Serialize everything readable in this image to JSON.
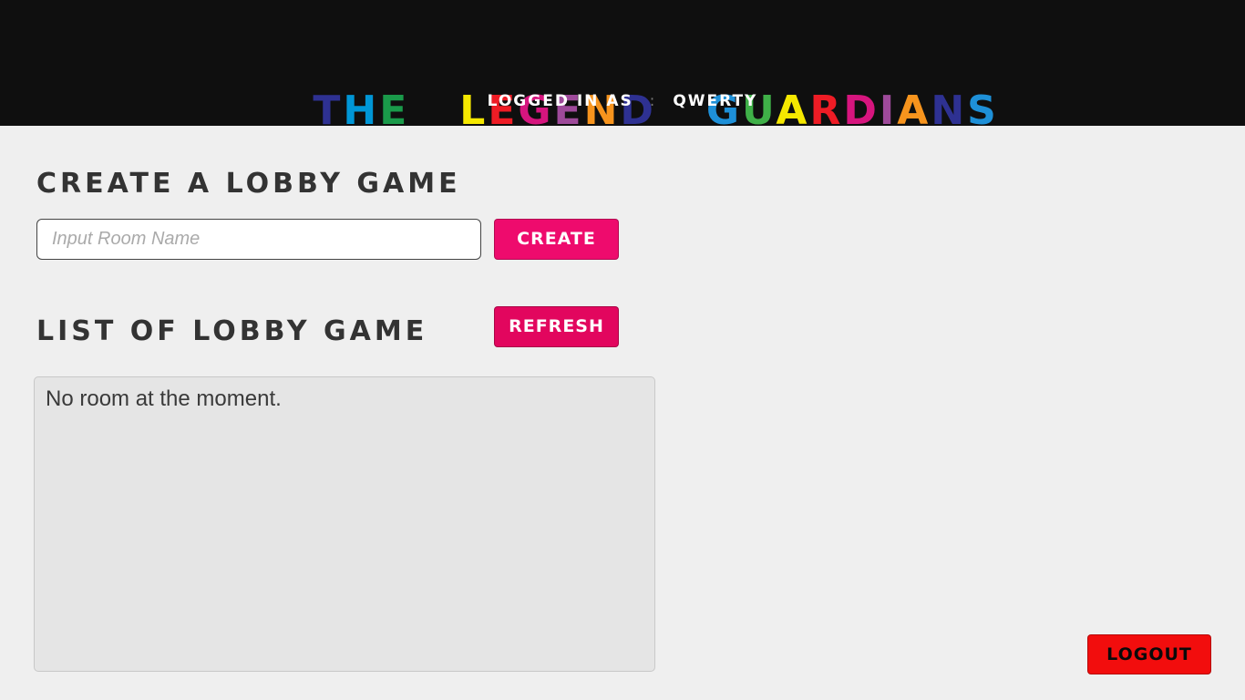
{
  "header": {
    "title_words": [
      {
        "text": "THE",
        "colors": [
          "#2e3192",
          "#0096d6",
          "#1a9a4a"
        ]
      },
      {
        "text": "LEGEND",
        "colors": [
          "#f5e800",
          "#ee1c25",
          "#d6157e",
          "#9e4a9a",
          "#f7941d",
          "#2e3192"
        ]
      },
      {
        "text": "GUARDIANS",
        "colors": [
          "#1e90d8",
          "#3fb048",
          "#f5e800",
          "#ee1c25",
          "#d6157e",
          "#9e4a9a",
          "#f7941d",
          "#2e3192",
          "#1e90d8"
        ]
      }
    ],
    "logged_in_label": "LOGGED IN AS",
    "separator": ":",
    "username": "QWERTY"
  },
  "create_section": {
    "title": "CREATE A LOBBY GAME",
    "room_input": {
      "value": "",
      "placeholder": "Input Room Name"
    },
    "create_label": "CREATE"
  },
  "list_section": {
    "title": "LIST OF LOBBY GAME",
    "refresh_label": "REFRESH",
    "empty_message": "No room at the moment."
  },
  "logout_label": "LOGOUT",
  "colors": {
    "header_bg": "#0f0f0f",
    "page_bg": "#efefef",
    "create_button": "#ee0b6d",
    "refresh_button": "#e2065e",
    "logout_button": "#f20d0d"
  }
}
